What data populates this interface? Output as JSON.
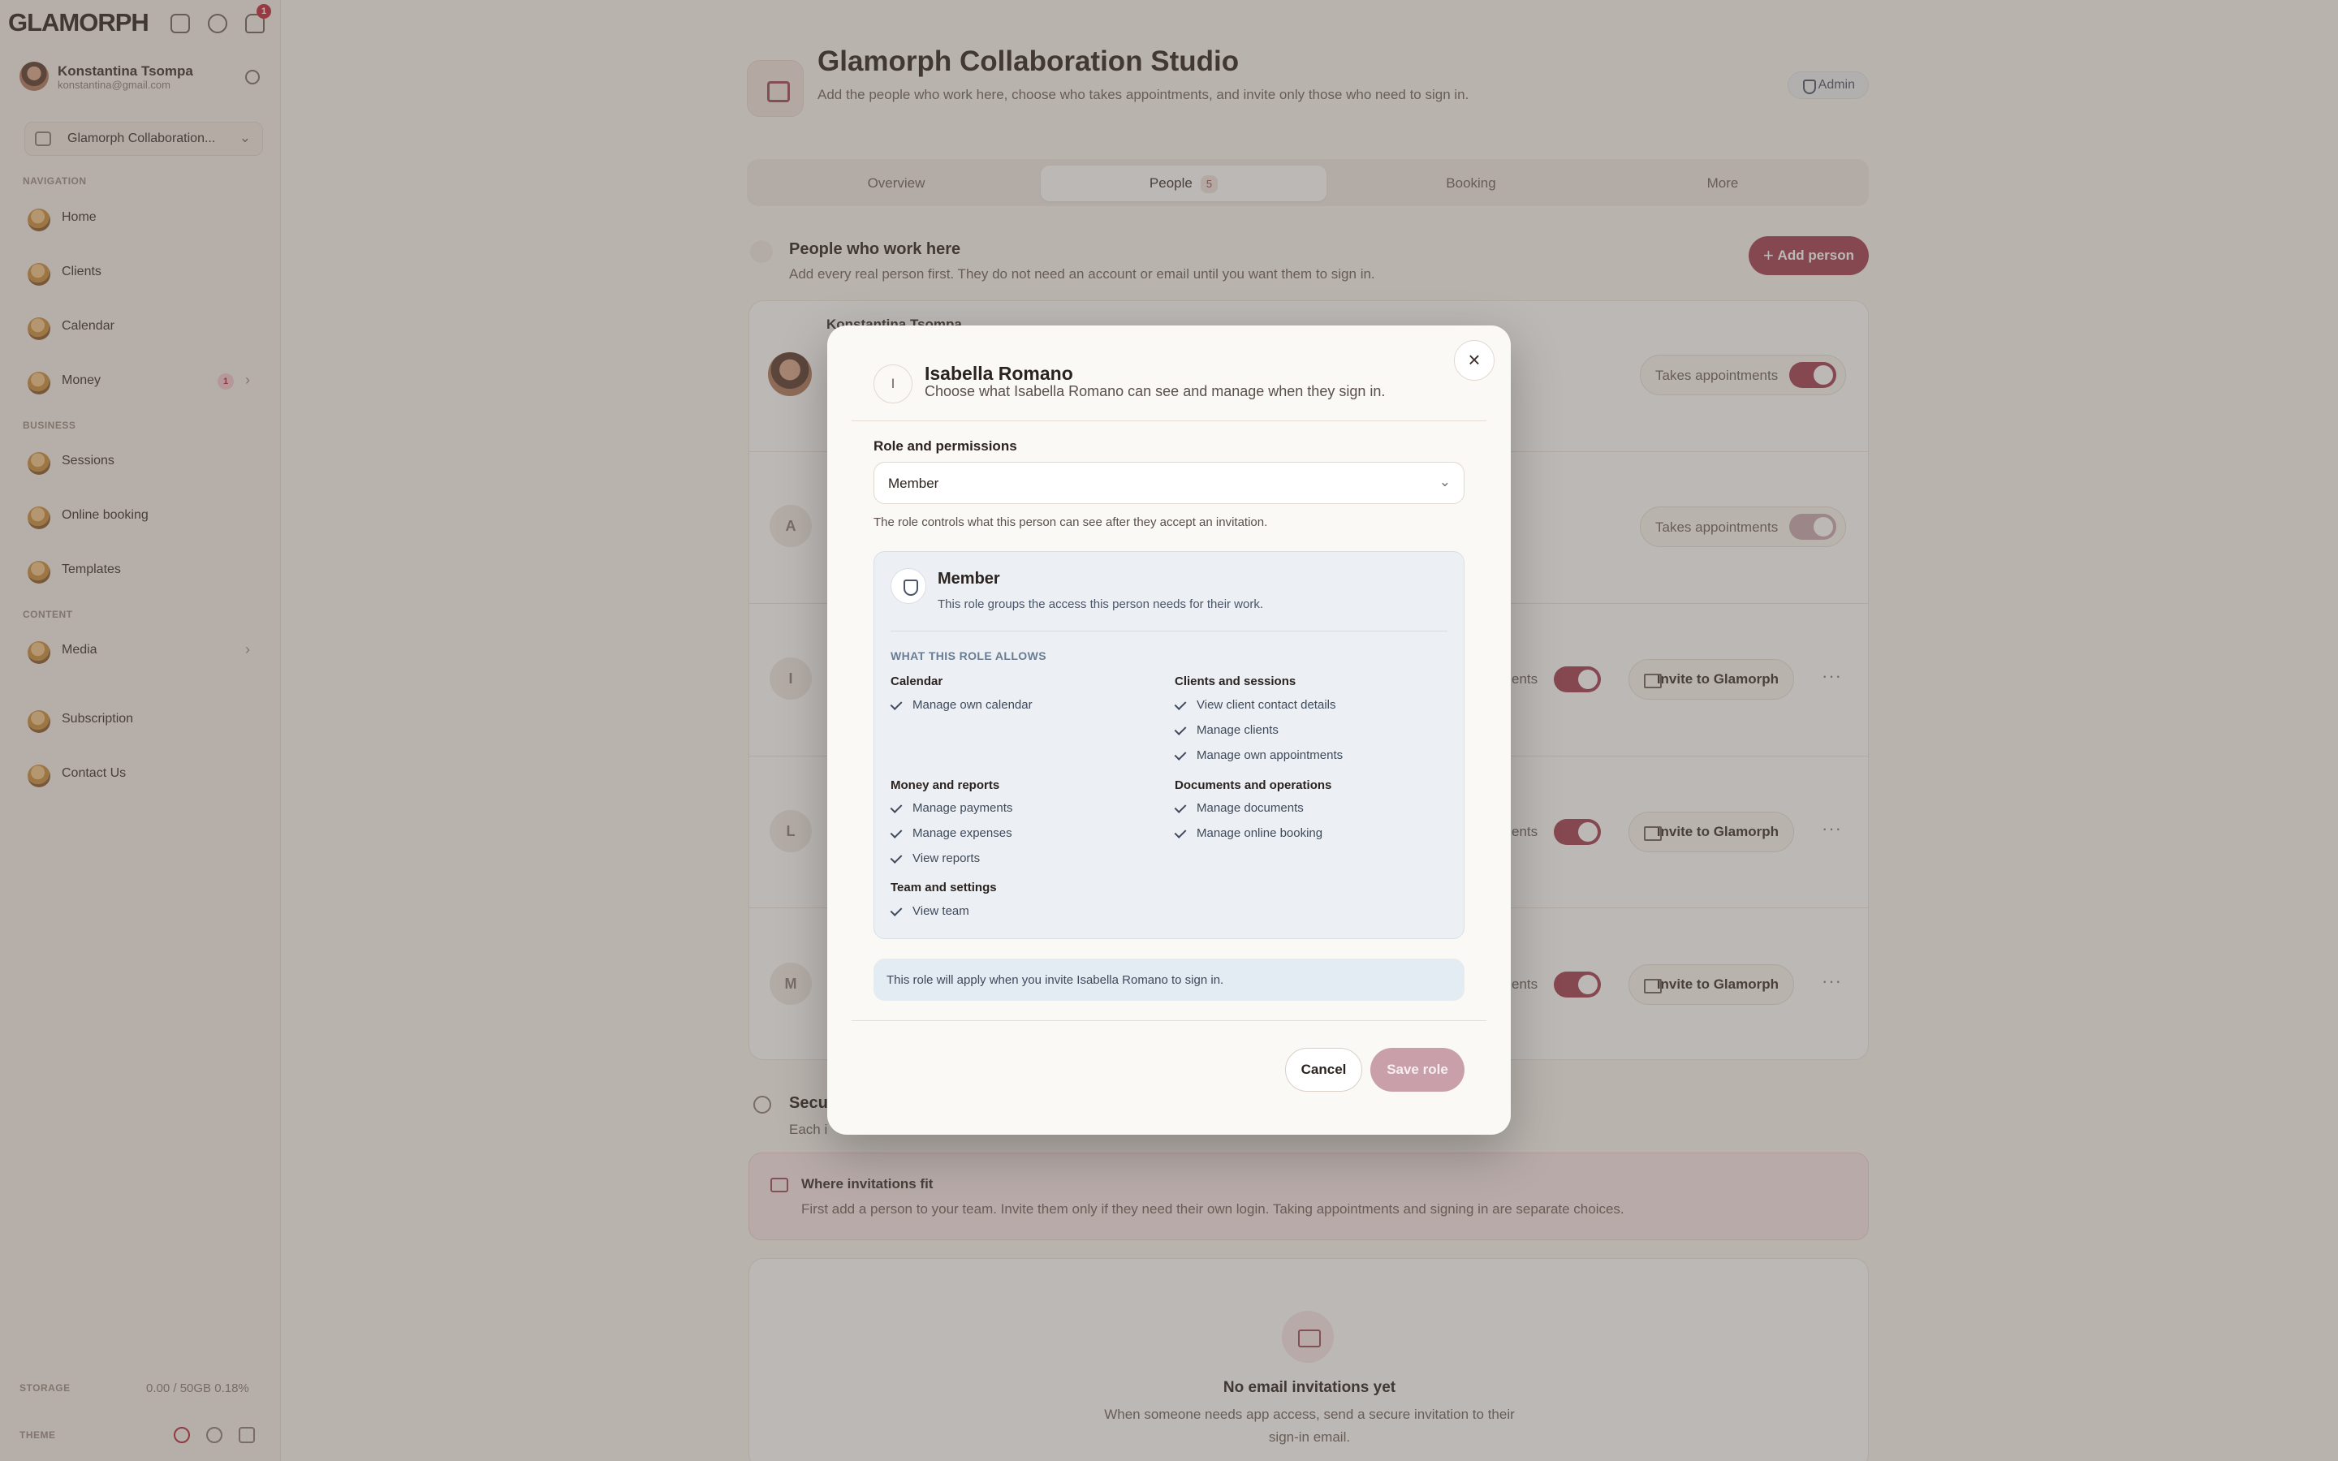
{
  "app": {
    "logo": "GLAMORPH",
    "notification_count": "1"
  },
  "user": {
    "name": "Konstantina Tsompa",
    "email": "konstantina@gmail.com"
  },
  "workspace": {
    "label": "Glamorph Collaboration..."
  },
  "sidebar": {
    "sections": {
      "navigation": "NAVIGATION",
      "business": "BUSINESS",
      "content": "CONTENT"
    },
    "items": [
      {
        "label": "Home"
      },
      {
        "label": "Clients"
      },
      {
        "label": "Calendar"
      },
      {
        "label": "Money",
        "badge": "1"
      },
      {
        "label": "Sessions"
      },
      {
        "label": "Online booking"
      },
      {
        "label": "Templates"
      },
      {
        "label": "Media"
      },
      {
        "label": "Subscription"
      },
      {
        "label": "Contact Us"
      }
    ],
    "storage_label": "STORAGE",
    "storage_value": "0.00 / 50GB  0.18%",
    "theme_label": "THEME"
  },
  "main": {
    "title": "Glamorph Collaboration Studio",
    "subtitle": "Add the people who work here, choose who takes appointments, and invite only those who need to sign in.",
    "admin_badge": "Admin",
    "tabs": [
      {
        "label": "Overview"
      },
      {
        "label": "People",
        "count": "5"
      },
      {
        "label": "Booking"
      },
      {
        "label": "More"
      }
    ],
    "people_section": {
      "title": "People who work here",
      "subtitle": "Add every real person first. They do not need an account or email until you want them to sign in.",
      "add_button": "Add person",
      "first_person_name": "Konstantina Tsompa",
      "takes_appointments": "Takes appointments",
      "invite_label": "Invite to Glamorph",
      "appointments_partial": "ents",
      "rows": [
        {
          "initial": "A"
        },
        {
          "initial": "I"
        },
        {
          "initial": "L"
        },
        {
          "initial": "M"
        }
      ]
    },
    "security": {
      "title": "Secu",
      "subtitle": "Each i"
    },
    "where_invitations": {
      "title": "Where invitations fit",
      "subtitle": "First add a person to your team. Invite them only if they need their own login. Taking appointments and signing in are separate choices."
    },
    "empty_state": {
      "title": "No email invitations yet",
      "subtitle": "When someone needs app access, send a secure invitation to their sign-in email."
    }
  },
  "modal": {
    "avatar_initial": "I",
    "title": "Isabella Romano",
    "subtitle": "Choose what Isabella Romano can see and manage when they sign in.",
    "role_label": "Role and permissions",
    "role_value": "Member",
    "role_hint": "The role controls what this person can see after they accept an invitation.",
    "role_card": {
      "title": "Member",
      "subtitle": "This role groups the access this person needs for their work.",
      "allows_label": "WHAT THIS ROLE ALLOWS",
      "groups": [
        {
          "title": "Calendar",
          "items": [
            "Manage own calendar"
          ]
        },
        {
          "title": "Clients and sessions",
          "items": [
            "View client contact details",
            "Manage clients",
            "Manage own appointments"
          ]
        },
        {
          "title": "Money and reports",
          "items": [
            "Manage payments",
            "Manage expenses",
            "View reports"
          ]
        },
        {
          "title": "Documents and operations",
          "items": [
            "Manage documents",
            "Manage online booking"
          ]
        },
        {
          "title": "Team and settings",
          "items": [
            "View team"
          ]
        }
      ]
    },
    "info": "This role will apply when you invite Isabella Romano to sign in.",
    "cancel": "Cancel",
    "save": "Save role"
  }
}
